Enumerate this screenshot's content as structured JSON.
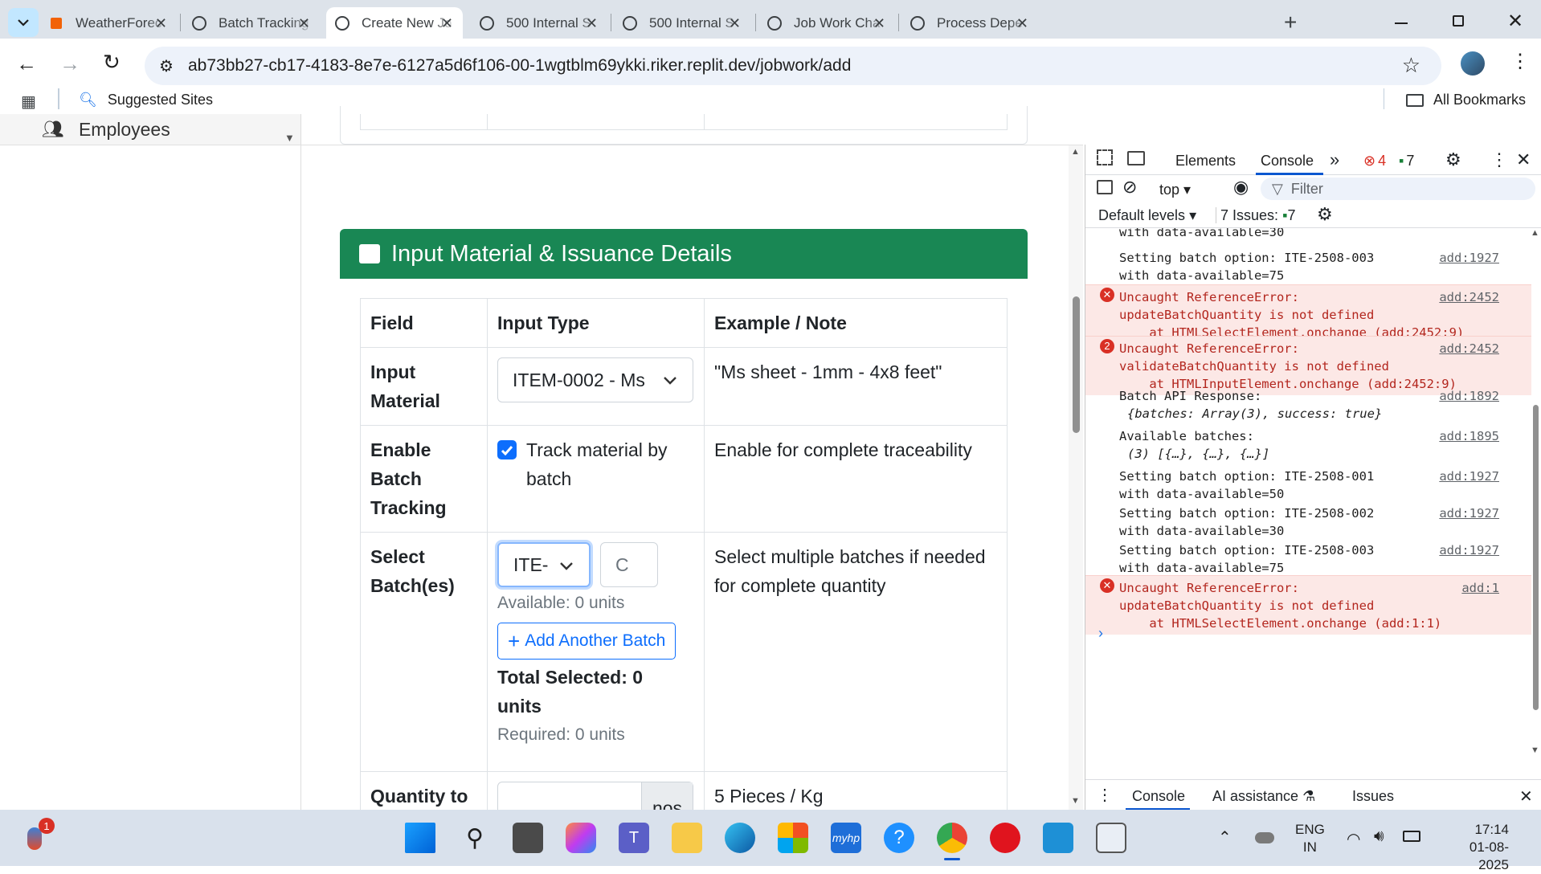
{
  "browser": {
    "tabs": [
      {
        "label": "WeatherForec",
        "icon": "replit-icon"
      },
      {
        "label": "Batch Tracking",
        "icon": "globe-icon"
      },
      {
        "label": "Create New Jo",
        "icon": "globe-icon"
      },
      {
        "label": "500 Internal S",
        "icon": "globe-icon"
      },
      {
        "label": "500 Internal S",
        "icon": "globe-icon"
      },
      {
        "label": "Job Work Cha",
        "icon": "globe-icon"
      },
      {
        "label": "Process Depe",
        "icon": "openai-icon"
      }
    ],
    "url": "ab73bb27-cb17-4183-8e7e-6127a5d6f106-00-1wgtblm69ykki.riker.replit.dev/jobwork/add",
    "bookmarks": {
      "suggested": "Suggested Sites",
      "all": "All Bookmarks"
    }
  },
  "sidebar": {
    "employees": "Employees"
  },
  "section": {
    "title": "Input Material & Issuance Details",
    "headers": [
      "Field",
      "Input Type",
      "Example / Note"
    ],
    "rows": {
      "input_material": {
        "field_line1": "Input",
        "field_line2": "Material",
        "select": "ITEM-0002 - Ms",
        "note": "\"Ms sheet - 1mm - 4x8 feet\""
      },
      "batch_tracking": {
        "field_line1": "Enable",
        "field_line2": "Batch",
        "field_line3": "Tracking",
        "checkbox_line1": "Track material by",
        "checkbox_line2": "batch",
        "checked": true,
        "note": "Enable for complete traceability"
      },
      "select_batches": {
        "field_line1": "Select",
        "field_line2": "Batch(es)",
        "select": "ITE-",
        "qty_placeholder": "C",
        "available": "Available: 0 units",
        "add_button": "Add Another Batch",
        "total_line1": "Total Selected: 0",
        "total_line2": "units",
        "required": "Required: 0 units",
        "note_line1": "Select multiple batches if needed",
        "note_line2": "for complete quantity"
      },
      "quantity": {
        "field": "Quantity to",
        "unit": "nos",
        "note": "5 Pieces / Kg"
      }
    }
  },
  "devtools": {
    "tabs": {
      "elements": "Elements",
      "console": "Console"
    },
    "errors_count": "4",
    "messages_count": "7",
    "context": "top",
    "filter_placeholder": "Filter",
    "levels": "Default levels",
    "issues_label": "7 Issues:",
    "issues_count": "7",
    "console_lines": [
      {
        "text1": "with data-available=30",
        "text2": "",
        "text3": "",
        "link": "",
        "err": false
      },
      {
        "text1": "Setting batch option: ITE-2508-003",
        "text2": "with data-available=75",
        "text3": "",
        "link": "add:1927",
        "err": false
      },
      {
        "text1": "Uncaught ReferenceError:",
        "text2": "updateBatchQuantity is not defined",
        "text3": "    at HTMLSelectElement.onchange (add:2452:9)",
        "link": "add:2452",
        "err": true,
        "badge": ""
      },
      {
        "text1": "Uncaught ReferenceError:",
        "text2": "validateBatchQuantity is not defined",
        "text3": "    at HTMLInputElement.onchange (add:2452:9)",
        "link": "add:2452",
        "err": true,
        "badge": "2"
      },
      {
        "text1": "Batch API Response:",
        "text2": "{batches: Array(3), success: true}",
        "text3": "",
        "link": "add:1892",
        "err": false
      },
      {
        "text1": "Available batches:",
        "text2": "(3) [{…}, {…}, {…}]",
        "text3": "",
        "link": "add:1895",
        "err": false
      },
      {
        "text1": "Setting batch option: ITE-2508-001",
        "text2": "with data-available=50",
        "text3": "",
        "link": "add:1927",
        "err": false
      },
      {
        "text1": "Setting batch option: ITE-2508-002",
        "text2": "with data-available=30",
        "text3": "",
        "link": "add:1927",
        "err": false
      },
      {
        "text1": "Setting batch option: ITE-2508-003",
        "text2": "with data-available=75",
        "text3": "",
        "link": "add:1927",
        "err": false
      },
      {
        "text1": "Uncaught ReferenceError:",
        "text2": "updateBatchQuantity is not defined",
        "text3": "    at HTMLSelectElement.onchange (add:1:1)",
        "link": "add:1",
        "err": true,
        "badge": ""
      }
    ],
    "drawer": {
      "console": "Console",
      "ai": "AI assistance",
      "issues": "Issues"
    }
  },
  "taskbar": {
    "lang1": "ENG",
    "lang2": "IN",
    "time": "17:14",
    "date": "01-08-2025",
    "notif": "1"
  }
}
